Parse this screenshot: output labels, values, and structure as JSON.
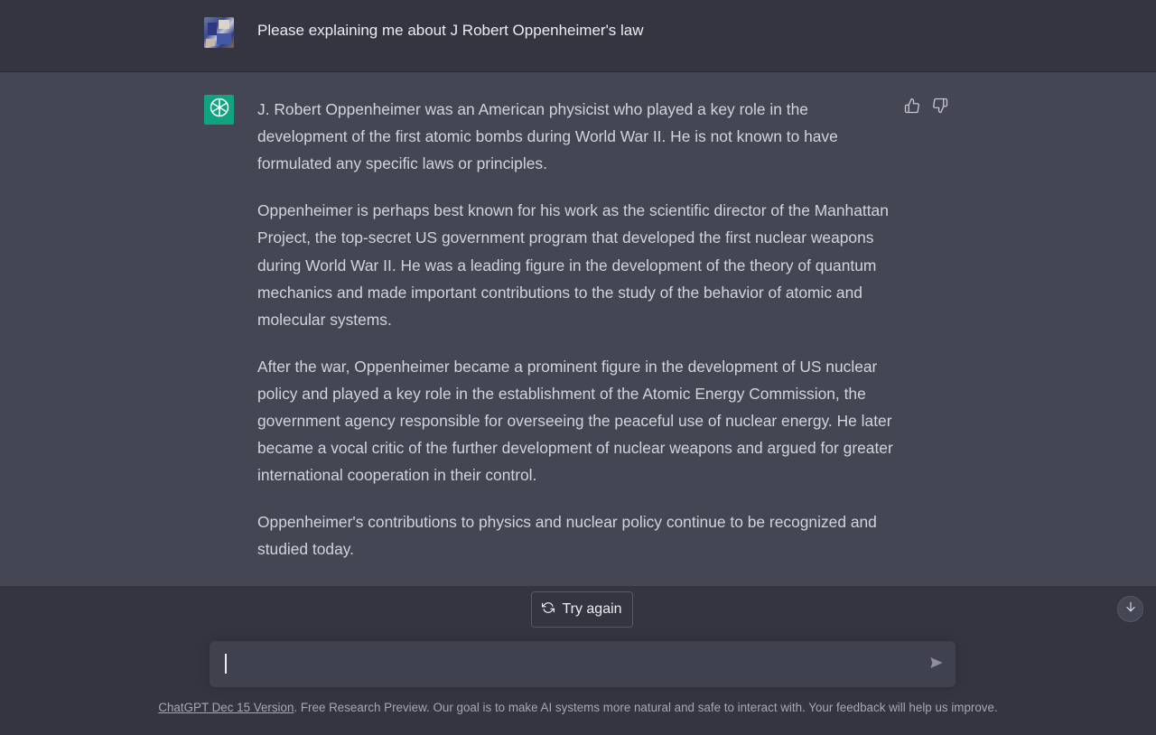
{
  "user_message": {
    "text": "Please explaining me about J Robert Oppenheimer's law"
  },
  "assistant_message": {
    "paragraphs": [
      "J. Robert Oppenheimer was an American physicist who played a key role in the development of the first atomic bombs during World War II. He is not known to have formulated any specific laws or principles.",
      "Oppenheimer is perhaps best known for his work as the scientific director of the Manhattan Project, the top-secret US government program that developed the first nuclear weapons during World War II. He was a leading figure in the development of the theory of quantum mechanics and made important contributions to the study of the behavior of atomic and molecular systems.",
      "After the war, Oppenheimer became a prominent figure in the development of US nuclear policy and played a key role in the establishment of the Atomic Energy Commission, the government agency responsible for overseeing the peaceful use of nuclear energy. He later became a vocal critic of the further development of nuclear weapons and argued for greater international cooperation in their control.",
      "Oppenheimer's contributions to physics and nuclear policy continue to be recognized and studied today."
    ],
    "feedback_icons": [
      "thumbs-up-icon",
      "thumbs-down-icon"
    ]
  },
  "controls": {
    "try_again_label": "Try again",
    "input_value": "",
    "icons": [
      "refresh-icon",
      "arrow-down-icon",
      "send-icon",
      "openai-logo-icon"
    ]
  },
  "footer": {
    "link_text": "ChatGPT Dec 15 Version",
    "rest_text": ". Free Research Preview. Our goal is to make AI systems more natural and safe to interact with. Your feedback will help us improve."
  },
  "colors": {
    "background": "#343541",
    "assistant_background": "#444654",
    "input_background": "#40414f",
    "brand_green": "#10a37f"
  }
}
